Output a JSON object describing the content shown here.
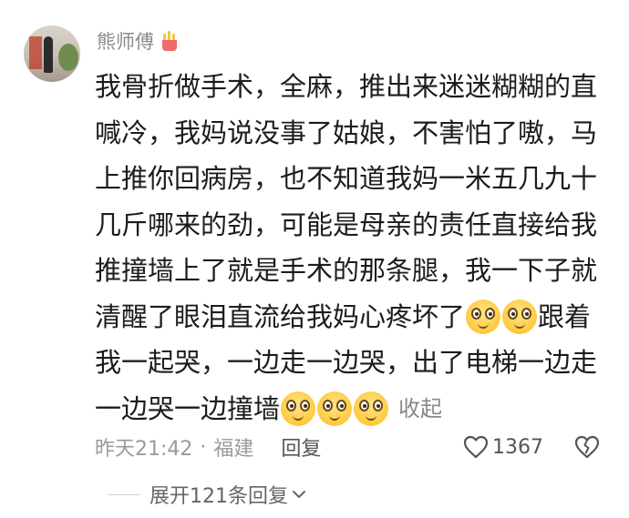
{
  "comment": {
    "username": "熊师傅",
    "badge_icon": "fries-badge-icon",
    "lines": [
      [
        "我骨折做手术，全麻，推出来迷迷糊糊的直"
      ],
      [
        "喊冷，我妈说没事了姑娘，不害怕了嗷，马"
      ],
      [
        "上推你回病房，也不知道我妈一米五几九十"
      ],
      [
        "几斤哪来的劲，可能是母亲的责任直接给我"
      ],
      [
        "推撞墙上了就是手术的那条腿，我一下子就"
      ],
      [
        "清醒了眼泪直流给我妈心疼坏了",
        "跟着"
      ],
      [
        "我一起哭，一边走一边哭，出了电梯一边走"
      ],
      [
        "一边哭一边撞墙"
      ]
    ],
    "emoji_name": "wide-eyed-smile-emoji",
    "collapse_label": "收起",
    "time": "昨天21:42",
    "separator": "·",
    "location": "福建",
    "reply_label": "回复",
    "like_count": "1367",
    "expand_replies_label": "展开121条回复"
  }
}
